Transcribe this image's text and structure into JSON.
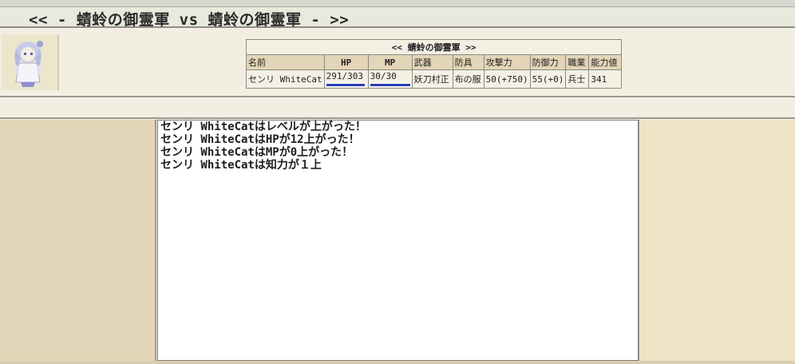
{
  "header": {
    "title": "<< - 蜻蛉の御霊軍 vs 蜻蛉の御霊軍 - >>"
  },
  "status_table": {
    "title": "<< 蜻蛉の御霊軍 >>",
    "columns": [
      "名前",
      "HP",
      "MP",
      "武器",
      "防具",
      "攻撃力",
      "防御力",
      "職業",
      "能力値"
    ],
    "row": {
      "name": "センリ WhiteCat",
      "hp": "291/303",
      "mp": "30/30",
      "weapon": "妖刀村正",
      "armor": "布の服",
      "attack": "50(+750)",
      "defense": "55(+0)",
      "job": "兵士",
      "ability": "341"
    },
    "hp_fraction": 0.96,
    "mp_fraction": 1.0
  },
  "battle_log": {
    "lines": [
      "センリ WhiteCatはレベルが上がった！",
      "センリ WhiteCatはHPが12上がった！",
      "センリ WhiteCatはMPが0上がった！",
      "センリ WhiteCatは知力が１上"
    ]
  },
  "avatar": {
    "icon": "character-portrait-icon"
  },
  "colors": {
    "panel_bg": "#e3d5b7",
    "title_bg": "#e6e9dc",
    "bar_blue": "#2a3bb7"
  }
}
